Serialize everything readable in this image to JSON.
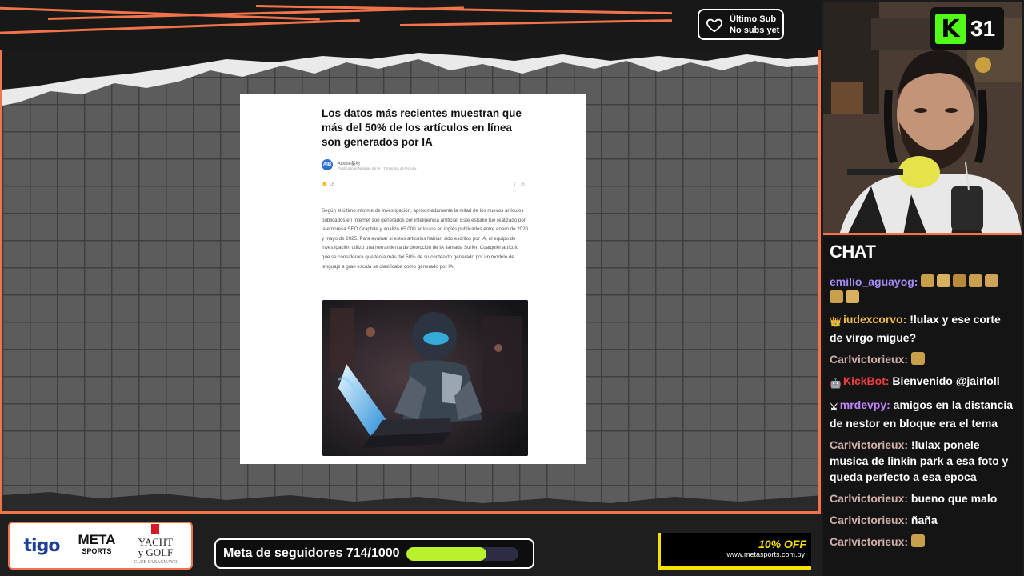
{
  "overlay": {
    "last_sub_title": "Último Sub",
    "last_sub_value": "No subs yet",
    "kick_count": "31",
    "kick_logo": "K"
  },
  "article": {
    "title": "Los datos más recientes muestran que más del 50% de los artículos en línea son generados por IA",
    "author_avatar": "AIB",
    "author": "Aibase基地",
    "meta": "Publicado el Noticias de IA  ·  7 minutos de lectura  ·",
    "reactions": "18",
    "body": "Según el último informe de investigación, aproximadamente la mitad de los nuevos artículos publicados en Internet son generados por inteligencia artificial. Este estudio fue realizado por la empresa SEO Graphite y analizó 65.000 artículos en inglés publicados entre enero de 2020 y mayo de 2025. Para evaluar si estos artículos habían sido escritos por IA, el equipo de investigación utilizó una herramienta de detección de IA llamada Surfer. Cualquier artículo que se considerara que tenía más del 50% de su contenido generado por un modelo de lenguaje a gran escala se clasificaba como generado por IA."
  },
  "sponsors": {
    "tigo": "tigo",
    "meta_1": "META",
    "meta_2": "SPORTS",
    "yacht_1": "YACHT",
    "yacht_2": "y GOLF",
    "yacht_3": "CLUB PARAGUAYO"
  },
  "goal": {
    "label": "Meta de seguidores 714/1000",
    "current": 714,
    "target": 1000
  },
  "promo": {
    "headline": "10% OFF",
    "url": "www.metasports.com.py"
  },
  "colors": {
    "accent": "#f0734a",
    "goal_fill": "#b8f22c",
    "kick_green": "#53fc18",
    "promo_yellow": "#f5e100"
  },
  "chat": {
    "title": "CHAT",
    "messages": [
      {
        "user": "emilio_aguayog:",
        "color": "#a78bfa",
        "text": "",
        "emotes": 7
      },
      {
        "user": "iudexcorvo:",
        "color": "#f2c14e",
        "text": "!lulax y ese corte de virgo migue?",
        "badge": "crown-icon"
      },
      {
        "user": "Carlvictorieux:",
        "color": "#d2b0a8",
        "text": "",
        "emotes": 1
      },
      {
        "user": "KickBot:",
        "color": "#ef3e3e",
        "text": "Bienvenido @jairloll",
        "badge": "bot-icon"
      },
      {
        "user": "mrdevpy:",
        "color": "#c084fc",
        "text": "amigos en la distancia de nestor en bloque era el tema",
        "badge": "sword-icon"
      },
      {
        "user": "Carlvictorieux:",
        "color": "#d2b0a8",
        "text": "!lulax ponele musica de linkin park a esa foto y queda perfecto a esa epoca"
      },
      {
        "user": "Carlvictorieux:",
        "color": "#d2b0a8",
        "text": "bueno que malo"
      },
      {
        "user": "Carlvictorieux:",
        "color": "#d2b0a8",
        "text": "ñaña"
      },
      {
        "user": "Carlvictorieux:",
        "color": "#d2b0a8",
        "text": "",
        "emotes": 1
      }
    ]
  }
}
